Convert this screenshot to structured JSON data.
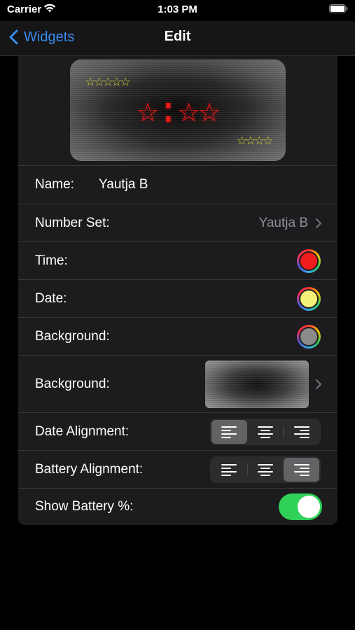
{
  "status": {
    "carrier": "Carrier",
    "time": "1:03 PM"
  },
  "nav": {
    "back_label": "Widgets",
    "title": "Edit"
  },
  "preview": {
    "date_text": "☆☆☆☆☆",
    "time_text": "☆:☆☆",
    "battery_text": "☆☆☆☆"
  },
  "rows": {
    "name_label": "Name:",
    "name_value": "Yautja B",
    "number_set_label": "Number Set:",
    "number_set_value": "Yautja B",
    "time_label": "Time:",
    "date_label": "Date:",
    "background_color_label": "Background:",
    "background_image_label": "Background:",
    "date_alignment_label": "Date Alignment:",
    "battery_alignment_label": "Battery Alignment:",
    "show_battery_label": "Show Battery %:"
  },
  "colors": {
    "time": "#f01c1c",
    "date": "#f5f077",
    "background": "#8a8a8a",
    "accent": "#3a8cf0",
    "toggle_on": "#30d158"
  },
  "date_alignment": {
    "options": [
      "left",
      "center",
      "right"
    ],
    "selected": "left"
  },
  "battery_alignment": {
    "options": [
      "left",
      "center",
      "right"
    ],
    "selected": "right"
  },
  "show_battery": true,
  "icons": {
    "back": "chevron-left-icon",
    "disclosure": "chevron-right-icon",
    "wifi": "wifi-icon",
    "battery": "battery-icon"
  }
}
